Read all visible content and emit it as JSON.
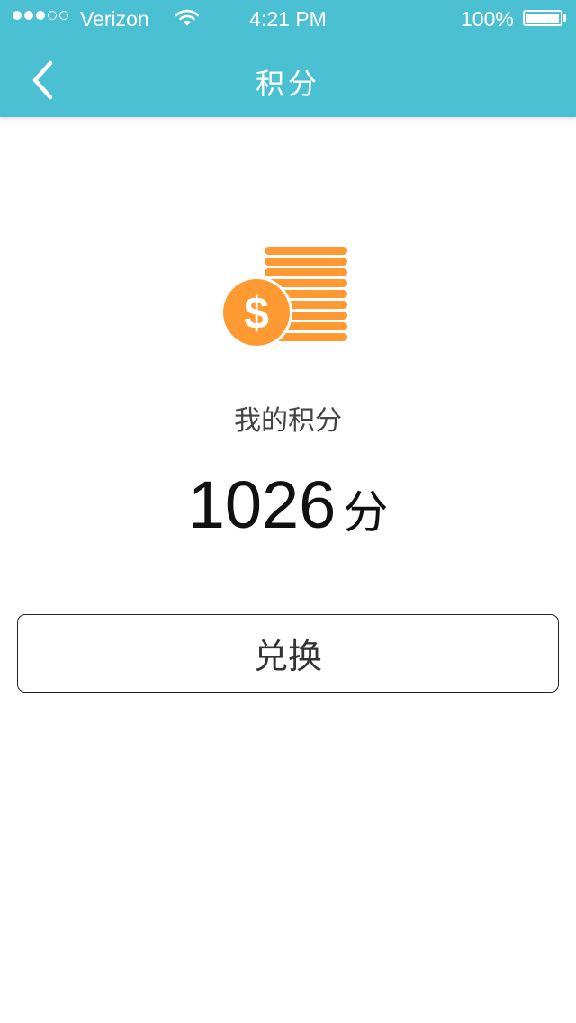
{
  "status_bar": {
    "carrier": "Verizon",
    "signal_bars_filled": 3,
    "signal_bars_total": 5,
    "time": "4:21 PM",
    "battery_percent": "100%",
    "icons": [
      "signal-dots-icon",
      "wifi-icon",
      "battery-icon"
    ]
  },
  "nav": {
    "title": "积分",
    "back_icon": "chevron-left-icon"
  },
  "main": {
    "icon": "coin-stack-dollar-icon",
    "label": "我的积分",
    "points_value": "1026",
    "points_unit": "分",
    "redeem_label": "兑换"
  },
  "colors": {
    "header": "#4bc0d3",
    "accent_orange": "#ff9a33",
    "background": "#ffffff"
  }
}
